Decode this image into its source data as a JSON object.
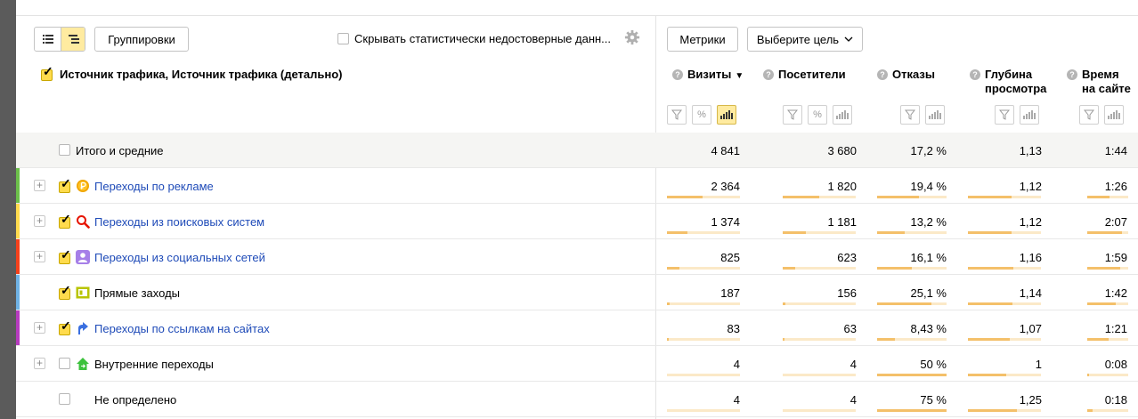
{
  "toolbar": {
    "groupings_label": "Группировки",
    "hide_unreliable_label": "Скрывать статистически недостоверные данн...",
    "metrics_label": "Метрики",
    "goal_label": "Выберите цель"
  },
  "header": {
    "dimension_title": "Источник трафика, Источник трафика (детально)",
    "question_mark": "?",
    "sort_indicator": "▼",
    "columns": [
      {
        "key": "visits",
        "line1": "Визиты",
        "line2": ""
      },
      {
        "key": "visitors",
        "line1": "Посетители",
        "line2": ""
      },
      {
        "key": "bounce",
        "line1": "Отказы",
        "line2": ""
      },
      {
        "key": "depth",
        "line1": "Глубина",
        "line2": "просмотра"
      },
      {
        "key": "time",
        "line1": "Время",
        "line2": "на сайте"
      }
    ],
    "percent_tool_glyph": "%"
  },
  "rows": {
    "total": {
      "label": "Итого и средние",
      "visits": "4 841",
      "visitors": "3 680",
      "bounce": "17,2 %",
      "depth": "1,13",
      "time": "1:44"
    },
    "items": [
      {
        "label": "Переходы по рекламе",
        "expandable": true,
        "checked": true,
        "link": true,
        "color": "#6cc04a",
        "icon": "coin-icon",
        "visits": "2 364",
        "visitors": "1 820",
        "bounce": "19,4 %",
        "depth": "1,12",
        "time": "1:26"
      },
      {
        "label": "Переходы из поисковых систем",
        "expandable": true,
        "checked": true,
        "link": true,
        "color": "#ffdb4d",
        "icon": "search-icon",
        "visits": "1 374",
        "visitors": "1 181",
        "bounce": "13,2 %",
        "depth": "1,12",
        "time": "2:07"
      },
      {
        "label": "Переходы из социальных сетей",
        "expandable": true,
        "checked": true,
        "link": true,
        "color": "#f5411c",
        "icon": "user-icon",
        "visits": "825",
        "visitors": "623",
        "bounce": "16,1 %",
        "depth": "1,16",
        "time": "1:59"
      },
      {
        "label": "Прямые заходы",
        "expandable": false,
        "checked": true,
        "link": false,
        "color": "#6fb2e5",
        "icon": "window-icon",
        "visits": "187",
        "visitors": "156",
        "bounce": "25,1 %",
        "depth": "1,14",
        "time": "1:42"
      },
      {
        "label": "Переходы по ссылкам на сайтах",
        "expandable": true,
        "checked": true,
        "link": true,
        "color": "#b63bbf",
        "icon": "arrow-link-icon",
        "visits": "83",
        "visitors": "63",
        "bounce": "8,43 %",
        "depth": "1,07",
        "time": "1:21"
      },
      {
        "label": "Внутренние переходы",
        "expandable": true,
        "checked": false,
        "link": false,
        "color": "",
        "icon": "home-icon",
        "visits": "4",
        "visitors": "4",
        "bounce": "50 %",
        "depth": "1",
        "time": "0:08"
      },
      {
        "label": "Не определено",
        "expandable": false,
        "checked": false,
        "link": false,
        "color": "",
        "icon": "",
        "visits": "4",
        "visitors": "4",
        "bounce": "75 %",
        "depth": "1,25",
        "time": "0:18"
      }
    ]
  },
  "bars": [
    {
      "visits": 0.49,
      "visitors": 0.5,
      "bounce": 0.6,
      "depth": 0.6,
      "time": 0.55
    },
    {
      "visits": 0.28,
      "visitors": 0.32,
      "bounce": 0.4,
      "depth": 0.6,
      "time": 0.85
    },
    {
      "visits": 0.17,
      "visitors": 0.17,
      "bounce": 0.5,
      "depth": 0.62,
      "time": 0.8
    },
    {
      "visits": 0.04,
      "visitors": 0.04,
      "bounce": 0.78,
      "depth": 0.61,
      "time": 0.7
    },
    {
      "visits": 0.02,
      "visitors": 0.02,
      "bounce": 0.26,
      "depth": 0.57,
      "time": 0.52
    },
    {
      "visits": 0.0,
      "visitors": 0.0,
      "bounce": 1.0,
      "depth": 0.53,
      "time": 0.05
    },
    {
      "visits": 0.0,
      "visitors": 0.0,
      "bounce": 1.0,
      "depth": 0.67,
      "time": 0.12
    }
  ]
}
